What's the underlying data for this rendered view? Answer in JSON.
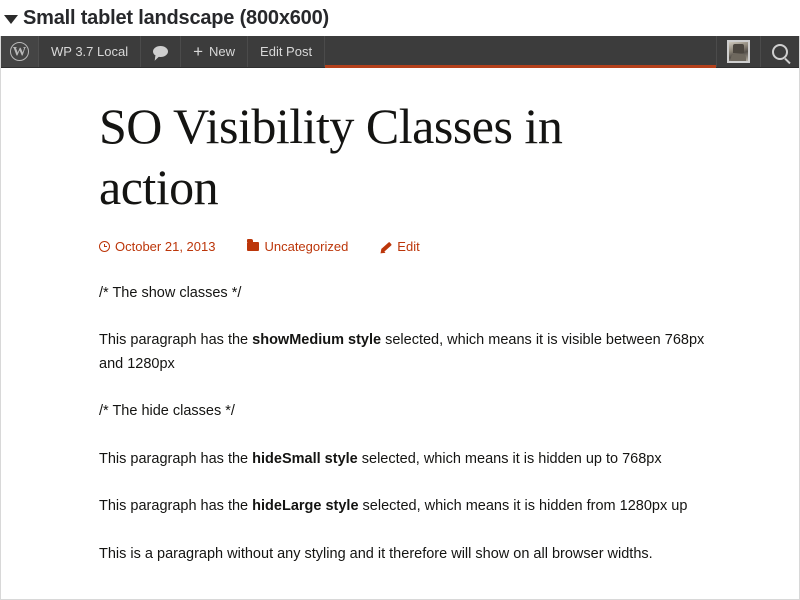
{
  "viewport": {
    "label": "Small tablet landscape (800x600)",
    "disclosure_icon": "triangle-down-icon"
  },
  "adminbar": {
    "logo_icon": "wordpress-logo-icon",
    "logo_glyph": "W",
    "site_name": "WP 3.7 Local",
    "comments_icon": "comment-bubble-icon",
    "new_plus_glyph": "+",
    "new_label": "New",
    "edit_post_label": "Edit Post",
    "avatar_icon": "user-avatar-icon",
    "search_icon": "search-icon",
    "hover_accent_color": "#b4401b",
    "background_color": "#3c3c3c"
  },
  "post": {
    "title": "SO Visibility Classes in action",
    "meta": {
      "date_icon": "clock-icon",
      "date": "October 21, 2013",
      "category_icon": "folder-icon",
      "category": "Uncategorized",
      "edit_icon": "pencil-icon",
      "edit_label": "Edit",
      "link_color": "#bc360a"
    },
    "paragraphs": [
      {
        "id": "show-classes-comment",
        "before": "/* The show classes */",
        "bold": "",
        "after": ""
      },
      {
        "id": "show-medium",
        "before": "This paragraph has the ",
        "bold": "showMedium style",
        "after": " selected, which means it is visible between 768px and 1280px"
      },
      {
        "id": "hide-classes-comment",
        "before": "/* The hide classes */",
        "bold": "",
        "after": ""
      },
      {
        "id": "hide-small",
        "before": "This paragraph has the ",
        "bold": "hideSmall style",
        "after": " selected, which means it is hidden up to 768px"
      },
      {
        "id": "hide-large",
        "before": "This paragraph has the ",
        "bold": "hideLarge style",
        "after": " selected, which means it is hidden from 1280px up"
      },
      {
        "id": "no-style",
        "before": "This is a paragraph without any styling and it therefore will show on all browser widths.",
        "bold": "",
        "after": ""
      }
    ]
  }
}
